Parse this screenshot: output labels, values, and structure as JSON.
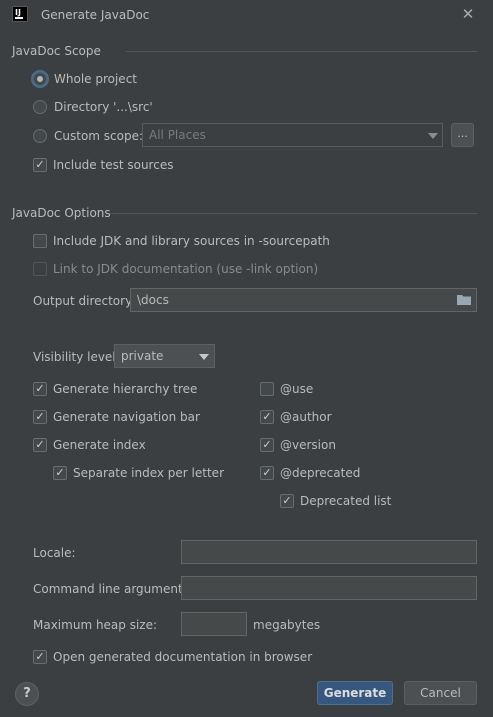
{
  "window": {
    "title": "Generate JavaDoc",
    "app_icon_text": "IJ"
  },
  "scope": {
    "title": "JavaDoc Scope",
    "whole_project": "Whole project",
    "directory": "Directory '...\\src'",
    "custom_scope": "Custom scope:",
    "custom_scope_value": "All Places",
    "browse_label": "...",
    "include_test_sources": "Include test sources"
  },
  "options": {
    "title": "JavaDoc Options",
    "include_jdk": "Include JDK and library sources in -sourcepath",
    "link_jdk": "Link to JDK documentation (use -link option)",
    "output_dir_label": "Output directory:",
    "output_dir_value": "\\docs",
    "visibility_label": "Visibility level:",
    "visibility_value": "private",
    "gen_hierarchy": "Generate hierarchy tree",
    "gen_navbar": "Generate navigation bar",
    "gen_index": "Generate index",
    "separate_index": "Separate index per letter",
    "use_tag": "@use",
    "author_tag": "@author",
    "version_tag": "@version",
    "deprecated_tag": "@deprecated",
    "deprecated_list": "Deprecated list",
    "locale_label": "Locale:",
    "locale_value": "",
    "cmd_args_label": "Command line arguments:",
    "cmd_args_value": "",
    "heap_label": "Maximum heap size:",
    "heap_value": "",
    "heap_unit": "megabytes",
    "open_in_browser": "Open generated documentation in browser"
  },
  "footer": {
    "help": "?",
    "generate": "Generate",
    "cancel": "Cancel"
  }
}
